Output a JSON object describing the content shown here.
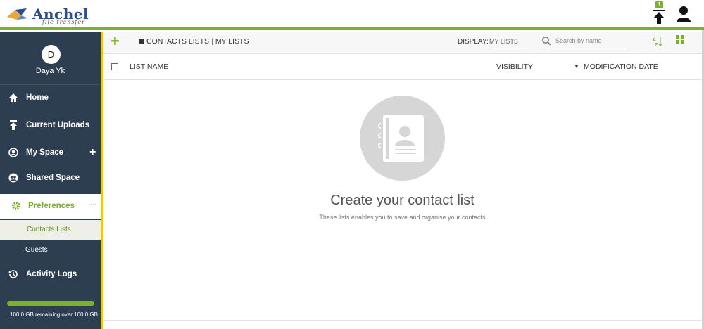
{
  "brand": {
    "name": "Anchel",
    "tagline": "file transfer"
  },
  "header": {
    "upload_count": "1"
  },
  "sidebar": {
    "user": {
      "initial": "D",
      "name": "Daya Yk"
    },
    "items": [
      {
        "label": "Home",
        "icon": "home-icon"
      },
      {
        "label": "Current Uploads",
        "icon": "upload-icon"
      },
      {
        "label": "My Space",
        "icon": "user-circle-icon"
      },
      {
        "label": "Shared Space",
        "icon": "shared-users-icon"
      },
      {
        "label": "Preferences",
        "icon": "gear-icon"
      },
      {
        "label": "Activity Logs",
        "icon": "history-icon"
      }
    ],
    "subitems": [
      {
        "label": "Contacts Lists"
      },
      {
        "label": "Guests"
      }
    ],
    "storage": {
      "text": "100.0 GB remaining over 100.0 GB",
      "used_fraction": 0.0
    }
  },
  "toolbar": {
    "crumb_root": "CONTACTS LISTS",
    "crumb_current": "MY LISTS",
    "display_label": "DISPLAY:",
    "display_value": "MY LISTS",
    "search_placeholder": "Search by name"
  },
  "table": {
    "columns": [
      "LIST NAME",
      "VISIBILITY",
      "MODIFICATION DATE"
    ]
  },
  "empty_state": {
    "title": "Create your contact list",
    "subtitle": "These lists enables you to save and organise your contacts"
  },
  "colors": {
    "accent": "#7ab12f",
    "sidebar_bg": "#2c3e50",
    "sidebar_accent": "#f0c419"
  }
}
